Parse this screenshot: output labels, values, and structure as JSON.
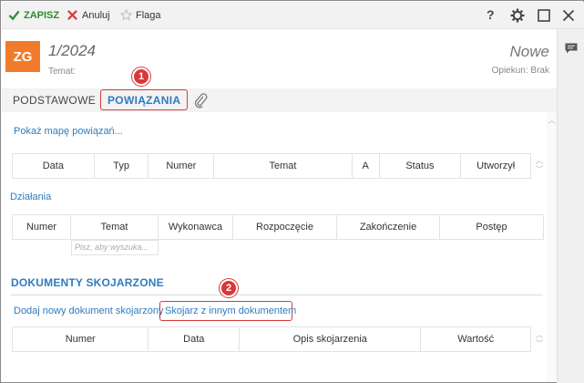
{
  "toolbar": {
    "save_label": "ZAPISZ",
    "cancel_label": "Anuluj",
    "flag_label": "Flaga",
    "help_label": "?"
  },
  "header": {
    "avatar_initials": "ZG",
    "doc_number": "1/2024",
    "subject_label": "Temat:",
    "state": "Nowe",
    "owner": "Opiekun: Brak"
  },
  "tabs": [
    {
      "label": "PODSTAWOWE"
    },
    {
      "label": "POWIĄZANIA"
    }
  ],
  "relations": {
    "show_map_link": "Pokaż mapę powiązań...",
    "columns": [
      "Data",
      "Typ",
      "Numer",
      "Temat",
      "A",
      "Status",
      "Utworzył"
    ]
  },
  "actions": {
    "title": "Działania",
    "columns": [
      "Numer",
      "Temat",
      "Wykonawca",
      "Rozpoczęcie",
      "Zakończenie",
      "Postęp"
    ],
    "filter_placeholder": "Pisz, aby wyszuka..."
  },
  "linked_docs": {
    "title": "DOKUMENTY SKOJARZONE",
    "add_link": "Dodaj nowy dokument skojarzony",
    "associate_link": "Skojarz z innym dokumentem",
    "columns": [
      "Numer",
      "Data",
      "Opis skojarzenia",
      "Wartość"
    ]
  },
  "callouts": [
    "1",
    "2"
  ],
  "colors": {
    "accent": "#2f7bbf",
    "avatar": "#f07b2a",
    "callout": "#d9383a",
    "save": "#2f8a2f"
  }
}
